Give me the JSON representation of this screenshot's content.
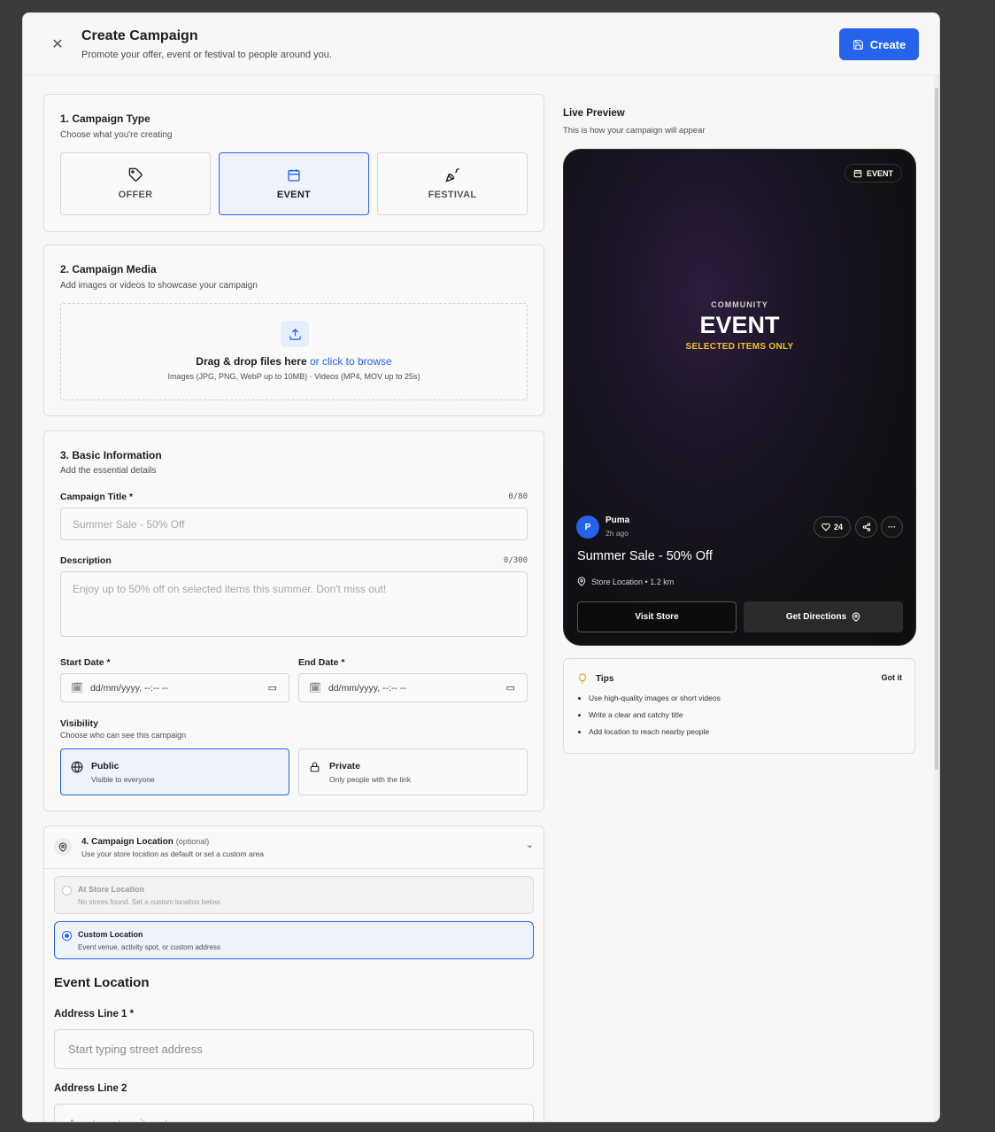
{
  "header": {
    "title": "Create Campaign",
    "subtitle": "Promote your offer, event or festival to people around you.",
    "create_label": "Create"
  },
  "campaign_type": {
    "heading": "1. Campaign Type",
    "desc": "Choose what you're creating",
    "options": [
      "OFFER",
      "EVENT",
      "FESTIVAL"
    ],
    "selected": "EVENT"
  },
  "media": {
    "heading": "2. Campaign Media",
    "desc": "Add images or videos to showcase your campaign",
    "drop_text": "Drag & drop files here",
    "browse_link": "or click to browse",
    "hint": "Images (JPG, PNG, WebP up to 10MB) · Videos (MP4, MOV up to 25s)"
  },
  "basic": {
    "heading": "3. Basic Information",
    "desc": "Add the essential details",
    "title_label": "Campaign Title *",
    "title_counter": "0/80",
    "title_placeholder": "Summer Sale - 50% Off",
    "desc_label": "Description",
    "desc_counter": "0/300",
    "desc_placeholder": "Enjoy up to 50% off on selected items this summer. Don't miss out!",
    "start_label": "Start Date *",
    "end_label": "End Date *",
    "date_placeholder": "dd/mm/yyyy, --:-- --",
    "visibility_label": "Visibility",
    "visibility_desc": "Choose who can see this campaign",
    "public_title": "Public",
    "public_desc": "Visible to everyone",
    "private_title": "Private",
    "private_desc": "Only people with the link"
  },
  "location": {
    "heading": "4. Campaign Location",
    "optional": "(optional)",
    "desc": "Use your store location as default or set a custom area",
    "store_title": "At Store Location",
    "store_desc": "No stores found. Set a custom location below.",
    "custom_title": "Custom Location",
    "custom_desc": "Event venue, activity spot, or custom address",
    "section_title": "Event Location",
    "addr1_label": "Address Line 1 *",
    "addr1_placeholder": "Start typing street address",
    "addr2_label": "Address Line 2",
    "addr2_placeholder": "Apartment, suite, etc."
  },
  "preview": {
    "title": "Live Preview",
    "subtitle": "This is how your campaign will appear",
    "badge": "EVENT",
    "eyebrow": "COMMUNITY",
    "big": "EVENT",
    "tagline": "SELECTED ITEMS ONLY",
    "avatar_letter": "P",
    "brand": "Puma",
    "time": "2h ago",
    "likes": "24",
    "headline": "Summer Sale - 50% Off",
    "location": "Store Location • 1.2 km",
    "visit_label": "Visit Store",
    "directions_label": "Get Directions"
  },
  "tips": {
    "title": "Tips",
    "dismiss": "Got it",
    "items": [
      "Use high-quality images or short videos",
      "Write a clear and catchy title",
      "Add location to reach nearby people"
    ]
  },
  "colors": {
    "accent": "#2563eb",
    "tagline": "#f0c030"
  }
}
